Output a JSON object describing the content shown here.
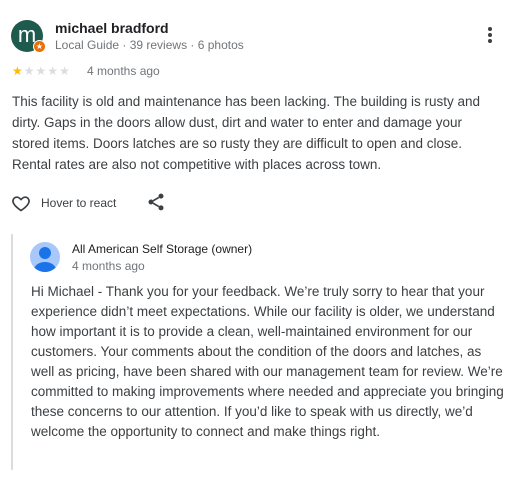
{
  "reviewer": {
    "initial": "m",
    "name": "michael bradford",
    "meta": "Local Guide · 39 reviews · 6 photos",
    "badge_icon": "star-icon",
    "avatar_color": "#1e5a4e",
    "badge_color": "#e8710a"
  },
  "rating": {
    "value": 1,
    "max": 5,
    "star_on_color": "#fbbc04",
    "star_off_color": "#dadce0"
  },
  "review": {
    "age": "4 months ago",
    "text": "This facility is old and maintenance has been lacking. The building is rusty and dirty. Gaps in the doors allow dust, dirt and water to enter and damage your stored items. Doors latches are so rusty they are difficult to open and close. Rental rates are also not competitive with places across town."
  },
  "actions": {
    "react_label": "Hover to react",
    "react_icon": "heart-outline-icon",
    "share_icon": "share-icon",
    "more_icon": "more-vert-icon"
  },
  "owner_reply": {
    "name": "All American Self Storage (owner)",
    "age": "4 months ago",
    "text": "Hi Michael - Thank you for your feedback. We’re truly sorry to hear that your experience didn’t meet expectations. While our facility is older, we understand how important it is to provide a clean, well-maintained environment for our customers. Your comments about the condition of the doors and latches, as well as pricing, have been shared with our management team for review. We’re committed to making improvements where needed and appreciate you bringing these concerns to our attention. If you’d like to speak with us directly, we’d welcome the opportunity to connect and make things right."
  }
}
